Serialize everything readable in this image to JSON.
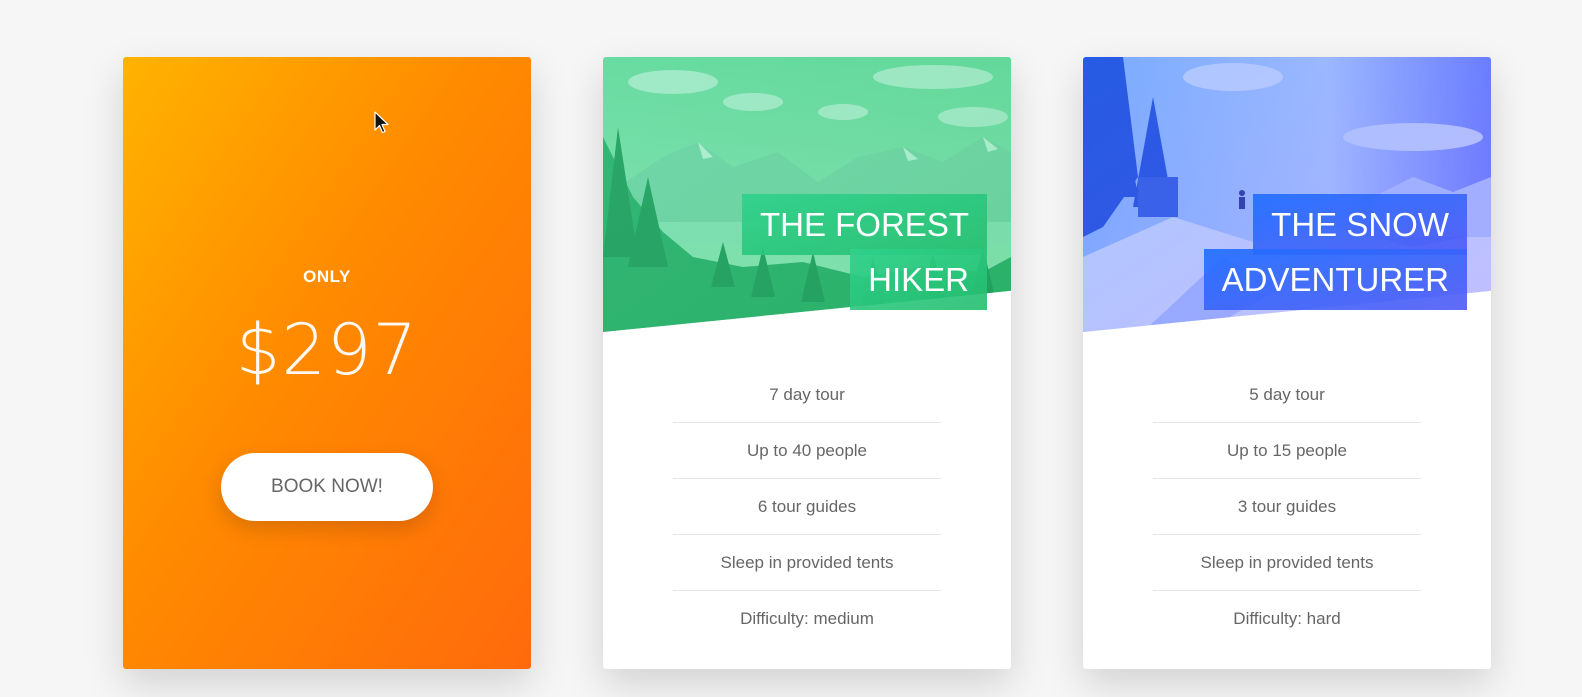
{
  "price_card": {
    "only_label": "ONLY",
    "price": "$297",
    "button_label": "BOOK NOW!",
    "gradient_colors": [
      "#ffb300",
      "#ff6a0c"
    ]
  },
  "tours": [
    {
      "heading_line1": "THE FOREST",
      "heading_line2": "HIKER",
      "accent_color": "#2ed18c",
      "details": [
        "7 day tour",
        "Up to 40 people",
        "6 tour guides",
        "Sleep in provided tents",
        "Difficulty: medium"
      ]
    },
    {
      "heading_line1": "THE SNOW",
      "heading_line2": "ADVENTURER",
      "accent_color": "#2b6cff",
      "details": [
        "5 day tour",
        "Up to 15 people",
        "3 tour guides",
        "Sleep in provided tents",
        "Difficulty: hard"
      ]
    }
  ],
  "icons": {
    "cursor": "mouse-pointer-icon"
  }
}
